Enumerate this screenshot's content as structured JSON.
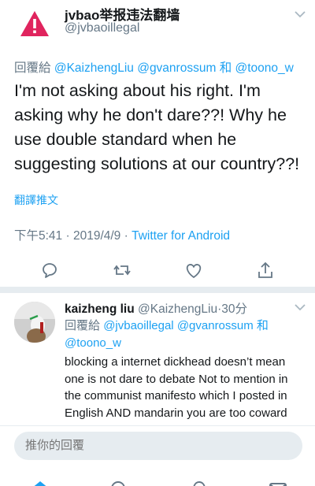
{
  "main_tweet": {
    "author_name": "jvbao举报违法翻墙",
    "author_handle": "@jvbaoillegal",
    "reply_prefix": "回覆給",
    "reply_mention_1": "@KaizhengLiu",
    "reply_mention_2": "@gvanrossum",
    "reply_and": "和",
    "reply_mention_3": "@toono_w",
    "text": "I'm not asking about his right. I'm asking why he don't dare??! Why he use double standard when he suggesting solutions at our country??!",
    "translate_label": "翻譯推文",
    "time": "下午5:41",
    "date": "2019/4/9",
    "source": "Twitter for Android",
    "separator": "·"
  },
  "reply_tweet": {
    "author_name": "kaizheng liu",
    "author_handle": "@KaizhengLiu",
    "separator": "·",
    "time_ago": "30分",
    "reply_prefix": "回覆給",
    "reply_mention_1": "@jvbaoillegal",
    "reply_mention_2": "@gvanrossum",
    "reply_and": "和",
    "reply_mention_3": "@toono_w",
    "text": "blocking a internet dickhead doesn’t mean one is not dare to debate   Not to mention  in the communist manifesto which I posted in English AND mandarin you are too coward"
  },
  "compose": {
    "placeholder": "推你的回覆"
  },
  "colors": {
    "accent": "#1da1f2",
    "secondary_text": "#657786",
    "warning": "#e0245e"
  },
  "icons": {
    "actions": [
      "reply-icon",
      "retweet-icon",
      "like-icon",
      "share-icon"
    ],
    "nav": [
      "home-icon",
      "search-icon",
      "notifications-icon",
      "messages-icon"
    ]
  }
}
